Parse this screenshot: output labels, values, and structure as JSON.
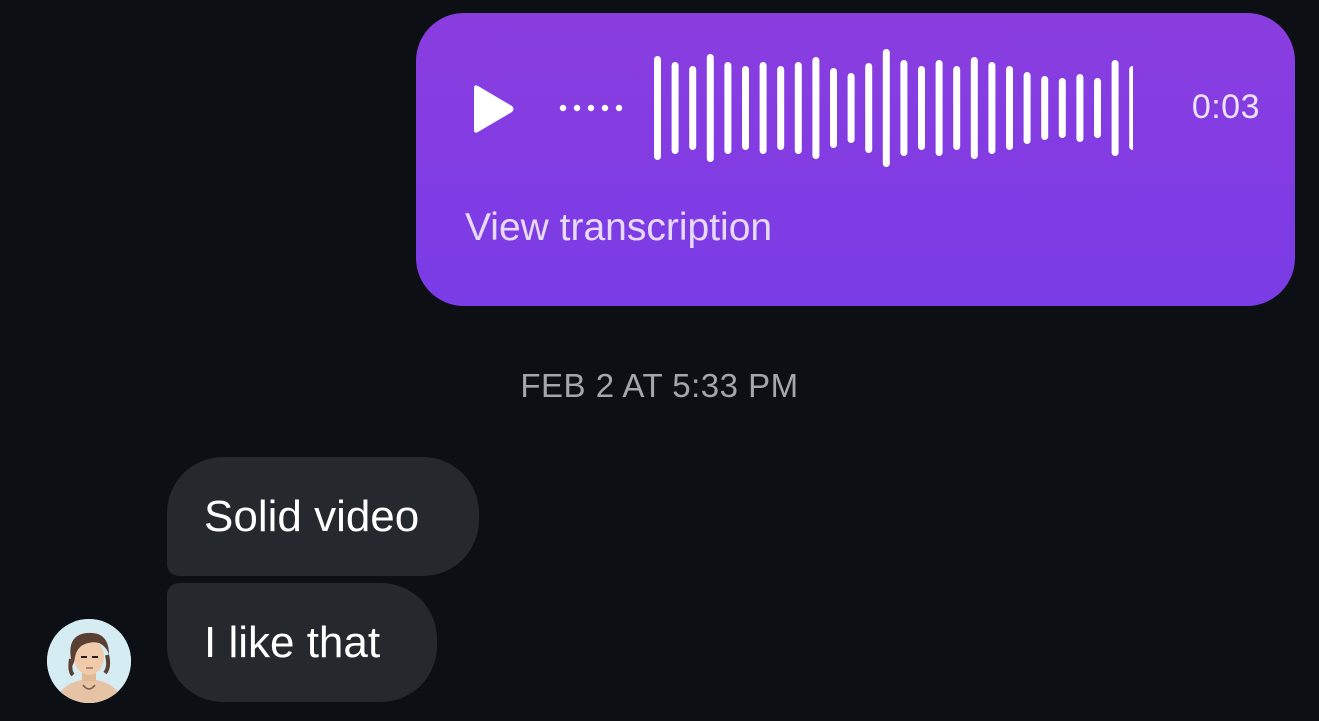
{
  "voice_message": {
    "duration": "0:03",
    "transcription_label": "View transcription",
    "play_icon": "play-icon"
  },
  "timestamp": "FEB 2 AT 5:33 PM",
  "messages": [
    {
      "text": "Solid video"
    },
    {
      "text": "I like that"
    }
  ],
  "colors": {
    "background": "#0c0f13",
    "voice_bubble": "#8438e2",
    "incoming_bubble": "#25292d"
  }
}
